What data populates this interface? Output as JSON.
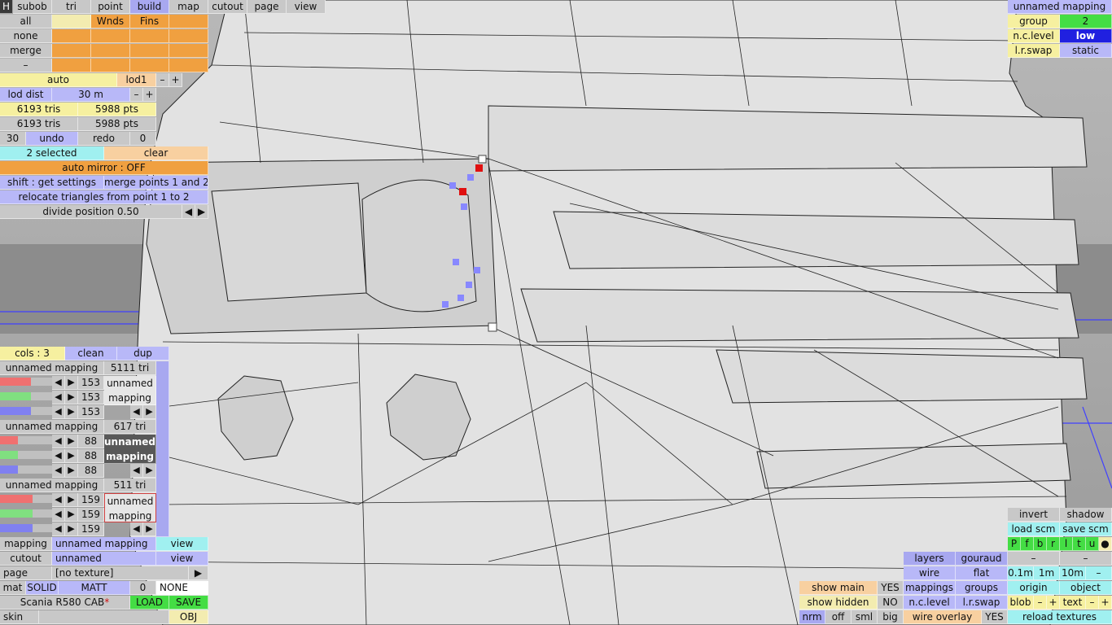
{
  "top_tabs": [
    "H",
    "subob",
    "tri",
    "point",
    "build",
    "map",
    "cutout",
    "page",
    "view"
  ],
  "build_panel": {
    "select_all": "all",
    "select_none": "none",
    "merge": "merge",
    "dash": "–",
    "wnds": "Wnds",
    "fins": "Fins",
    "auto": "auto",
    "lod": "lod1",
    "minus": "–",
    "plus": "+",
    "lod_dist_label": "lod dist",
    "lod_dist_value": "30 m",
    "tris_1": "6193 tris",
    "pts_1": "5988 pts",
    "tris_2": "6193 tris",
    "pts_2": "5988 pts",
    "undo_count": "30",
    "undo": "undo",
    "redo": "redo",
    "redo_count": "0",
    "selected": "2 selected",
    "clear": "clear",
    "auto_mirror": "auto mirror : OFF",
    "shift_settings": "shift : get settings",
    "merge_points": "merge points 1 and 2",
    "relocate": "relocate triangles from point 1 to 2",
    "divide_position": "divide position 0.50",
    "arrow_left": "◀",
    "arrow_right": "▶"
  },
  "mapping_panel": {
    "header": "unnamed mapping",
    "group_label": "group",
    "group_value": "2",
    "nclevel_label": "n.c.level",
    "nclevel_value": "low",
    "lrswap_label": "l.r.swap",
    "lrswap_value": "static"
  },
  "cols_panel": {
    "cols": "cols : 3",
    "clean": "clean",
    "dup": "dup",
    "entries": [
      {
        "name": "unnamed mapping",
        "tri": "5111 tri",
        "values": [
          "153",
          "153",
          "153"
        ],
        "preview": "unnamed mapping"
      },
      {
        "name": "unnamed mapping",
        "tri": "617 tri",
        "values": [
          "88",
          "88",
          "88"
        ],
        "preview": "unnamed mapping"
      },
      {
        "name": "unnamed mapping",
        "tri": "511 tri",
        "values": [
          "159",
          "159",
          "159"
        ],
        "preview": "unnamed mapping"
      }
    ],
    "colors": {
      "red": "#f07070",
      "green": "#80e080",
      "blue": "#8080f0",
      "gray": "#c0c0c0"
    }
  },
  "bottom_left": {
    "mapping_label": "mapping",
    "mapping_value": "unnamed mapping",
    "view": "view",
    "cutout_label": "cutout",
    "cutout_value": "unnamed",
    "view2": "view",
    "page_label": "page",
    "page_value": "[no texture]",
    "page_arrow": "▶",
    "mat": "mat",
    "solid": "SOLID",
    "matt": "MATT",
    "mat_num": "0",
    "none": "NONE",
    "model_name": "Scania R580 CAB",
    "model_star": "*",
    "load": "LOAD",
    "save": "SAVE",
    "skin": "skin",
    "obj": "OBJ"
  },
  "bottom_right": {
    "invert": "invert",
    "shadow": "shadow",
    "load_scm": "load scm",
    "save_scm": "save scm",
    "letters": [
      "P",
      "f",
      "b",
      "r",
      "l",
      "t",
      "u",
      "●"
    ],
    "dash": "–",
    "layers": "layers",
    "gouraud": "gouraud",
    "wire": "wire",
    "flat": "flat",
    "mappings": "mappings",
    "groups": "groups",
    "nclevel": "n.c.level",
    "lrswap": "l.r.swap",
    "dist1": "0.1m",
    "dist2": "1m",
    "dist3": "10m",
    "minus": "–",
    "origin": "origin",
    "object": "object",
    "blob": "blob",
    "plus": "+",
    "text": "text",
    "reload": "reload textures",
    "show_main": "show main",
    "show_main_val": "YES",
    "show_hidden": "show hidden",
    "show_hidden_val": "NO",
    "wire_overlay": "wire overlay",
    "wire_overlay_val": "YES",
    "sizes": [
      "nrm",
      "off",
      "sml",
      "big"
    ]
  }
}
